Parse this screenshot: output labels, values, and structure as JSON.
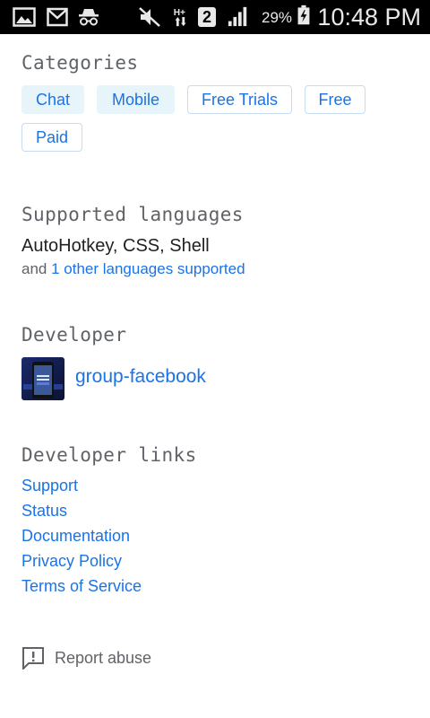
{
  "status_bar": {
    "battery_percent": "29%",
    "time": "10:48 PM",
    "sim_badge": "2",
    "network_type": "H+"
  },
  "categories": {
    "heading": "Categories",
    "chips": [
      {
        "label": "Chat"
      },
      {
        "label": "Mobile"
      },
      {
        "label": "Free Trials"
      },
      {
        "label": "Free"
      },
      {
        "label": "Paid"
      }
    ]
  },
  "languages": {
    "heading": "Supported languages",
    "list": "AutoHotkey, CSS, Shell",
    "more_prefix": "and ",
    "more_link": "1 other languages supported"
  },
  "developer": {
    "heading": "Developer",
    "name": "group-facebook"
  },
  "developer_links": {
    "heading": "Developer links",
    "items": [
      {
        "label": "Support"
      },
      {
        "label": "Status"
      },
      {
        "label": "Documentation"
      },
      {
        "label": "Privacy Policy"
      },
      {
        "label": "Terms of Service"
      }
    ]
  },
  "report": {
    "label": "Report abuse"
  },
  "colors": {
    "link": "#1a73e8",
    "chip_fill": "#e7f5fb",
    "chip_border": "#c7dcf0",
    "heading": "#5f6368"
  }
}
